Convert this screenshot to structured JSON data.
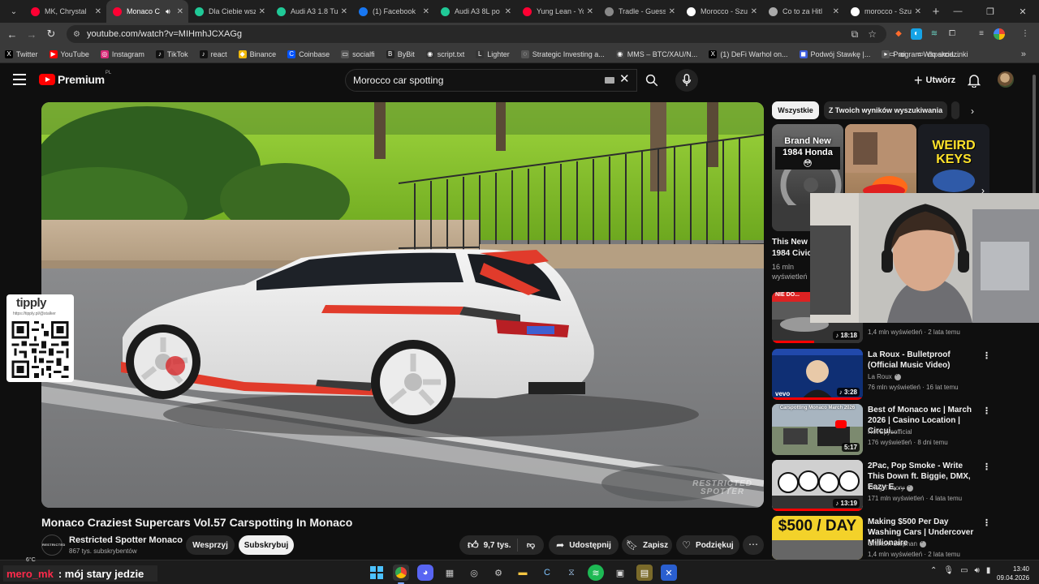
{
  "browser": {
    "tabs": [
      {
        "title": "MK, Chrystal",
        "favicon_color": "#ff0033"
      },
      {
        "title": "Monaco C",
        "favicon_color": "#ff0033",
        "active": true
      },
      {
        "title": "Dla Ciebie wsz",
        "favicon_color": "#20c997"
      },
      {
        "title": "Audi A3 1.8 Tu",
        "favicon_color": "#20c997"
      },
      {
        "title": "(1) Facebook",
        "favicon_color": "#1877f2"
      },
      {
        "title": "Audi A3 8L po",
        "favicon_color": "#20c997"
      },
      {
        "title": "Yung Lean - Yo",
        "favicon_color": "#ff0033"
      },
      {
        "title": "Tradle - Guess",
        "favicon_color": "#888888"
      },
      {
        "title": "Morocco - Szu",
        "favicon_color": "#ffffff"
      },
      {
        "title": "Co to za Hitl",
        "favicon_color": "#aaaaaa"
      },
      {
        "title": "morocco - Szu",
        "favicon_color": "#ffffff"
      }
    ],
    "url": "youtube.com/watch?v=MIHmhJCXAGg",
    "bookmarks": [
      {
        "label": "Twitter",
        "icon": "X",
        "color": "#000000"
      },
      {
        "label": "YouTube",
        "icon": "▶",
        "color": "#ff0000"
      },
      {
        "label": "Instagram",
        "icon": "◎",
        "color": "#d62976"
      },
      {
        "label": "TikTok",
        "icon": "♪",
        "color": "#111111"
      },
      {
        "label": "react",
        "icon": "♪",
        "color": "#111111"
      },
      {
        "label": "Binance",
        "icon": "◆",
        "color": "#f0b90b"
      },
      {
        "label": "Coinbase",
        "icon": "C",
        "color": "#0052ff"
      },
      {
        "label": "socialfi",
        "icon": "▭",
        "color": "#555555"
      },
      {
        "label": "ByBit",
        "icon": "B",
        "color": "#222222"
      },
      {
        "label": "script.txt",
        "icon": "◉",
        "color": "#333333"
      },
      {
        "label": "Lighter",
        "icon": "L",
        "color": "#333333"
      },
      {
        "label": "Strategic Investing a...",
        "icon": "◌",
        "color": "#555555"
      },
      {
        "label": "MMS – BTC/XAU/N...",
        "icon": "◉",
        "color": "#444444"
      },
      {
        "label": "(1) DeFi Warhol on...",
        "icon": "X",
        "color": "#000000"
      },
      {
        "label": "Podwój Stawkę |...",
        "icon": "◼",
        "color": "#3b5bdb"
      },
      {
        "label": "Program Wsparcia...",
        "icon": "▸",
        "color": "#555555"
      }
    ],
    "bookmarks_right": [
      {
        "label": "ai",
        "icon": "▭"
      },
      {
        "label": "do skodzinki",
        "icon": "▭"
      }
    ]
  },
  "youtube": {
    "logo_text": "Premium",
    "logo_region": "PL",
    "search_query": "Morocco car spotting",
    "create_label": "Utwórz"
  },
  "video": {
    "title": "Monaco Craziest Supercars Vol.57 Carspotting In Monaco",
    "watermark_line1": "RESTRICTED",
    "watermark_line2": "SPOTTER",
    "channel": "Restricted Spotter Monaco",
    "channel_avatar_text": "RESTRICTED",
    "subscribers": "867 tys. subskrybentów",
    "support_label": "Wesprzyj",
    "subscribe_label": "Subskrybuj",
    "likes": "9,7 tys.",
    "share_label": "Udostępnij",
    "save_label": "Zapisz",
    "thanks_label": "Podziękuj"
  },
  "tipply": {
    "logo": "tipply",
    "url": "https://tipply.pl/@stalker"
  },
  "sidebar": {
    "chips": [
      "Wszystkie",
      "Z Twoich wyników wyszukiwania"
    ],
    "shorts": [
      {
        "overlay_line1": "Brand New",
        "overlay_line2": "1984 Honda 😳",
        "overlay": "WEIRD KEYS"
      }
    ],
    "short_title_line1": "This New",
    "short_title_line2": "1984 Civic",
    "short_views_line1": "16 mln",
    "short_views_line2": "wyświetleń",
    "related": [
      {
        "title": "",
        "channel": "",
        "meta": "1,4 mln wyświetleń · 2 lata temu",
        "duration": "18:18",
        "thumb_text": "NIE DO..."
      },
      {
        "title": "La Roux - Bulletproof (Official Music Video)",
        "channel": "La Roux",
        "meta": "76 mln wyświetleń · 16 lat temu",
        "duration": "3:28",
        "thumb_text": "vevo"
      },
      {
        "title": "Best of Monaco ᴍᴄ | March 2026 | Casino Location | Circui...",
        "channel": "RevSpysofficial",
        "meta": "176 wyświetleń · 8 dni temu",
        "duration": "5:17",
        "thumb_text": "Carspotting Monaco March 2026"
      },
      {
        "title": "2Pac, Pop Smoke - Write This Down ft. Biggie, DMX, Eazy E, ...",
        "channel": "Thug Theory",
        "meta": "171 mln wyświetleń · 4 lata temu",
        "duration": "13:19",
        "thumb_text": ""
      },
      {
        "title": "Making $500 Per Day Washing Cars | Undercover Millionaire",
        "channel": "Graham Stephan",
        "meta": "1,4 mln wyświetleń · 2 lata temu",
        "duration": "",
        "thumb_text": "$500 / DAY"
      }
    ]
  },
  "taskbar": {
    "temperature": "6°C",
    "overlay_user": "mero_mk",
    "overlay_message": ": mój stary jedzie",
    "time": "13:40",
    "date": "09.04.2026"
  }
}
